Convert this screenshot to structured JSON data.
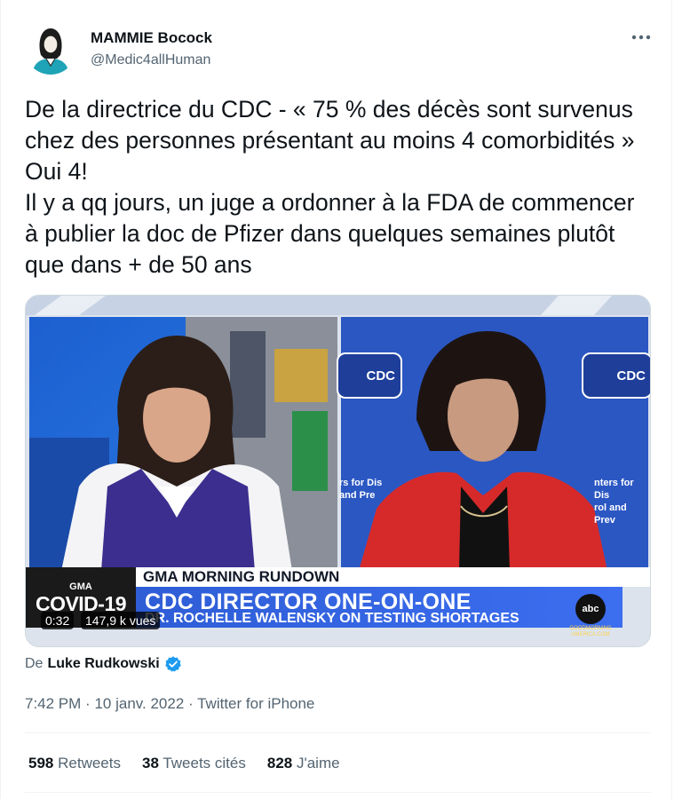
{
  "author": {
    "name": "MAMMIE Bocock",
    "handle": "@Medic4allHuman",
    "avatar_icon": "woman-portrait-avatar"
  },
  "more_icon": "more-options-icon",
  "tweet": {
    "text": "De la directrice du CDC - « 75 % des décès sont survenus chez des personnes présentant au moins 4 comorbidités » Oui 4!\nIl y a qq jours, un juge a ordonner à la FDA de commencer à publier la doc de Pfizer dans quelques semaines plutôt que dans + de 50 ans"
  },
  "video": {
    "duration": "0:32",
    "views": "147,9 k vues",
    "overlay": {
      "program": "GMA MORNING RUNDOWN",
      "headline": "CDC DIRECTOR ONE-ON-ONE",
      "subheadline": "DR. ROCHELLE WALENSKY ON TESTING SHORTAGES",
      "covid_small": "GMA",
      "covid_big": "COVID-19",
      "network": "abc",
      "network_url": "GOODMORNING AMERICA.COM",
      "cdc_logo": "CDC",
      "cdc_side_text": "nters for Dis\nrol and Prev",
      "cdc_side_text_left": "rs for Dis\nand Pre"
    }
  },
  "attribution": {
    "prefix": "De",
    "name": "Luke Rudkowski",
    "verified_icon": "verified-badge-icon"
  },
  "meta": {
    "time": "7:42 PM",
    "date": "10 janv. 2022",
    "source": "Twitter for iPhone",
    "separator": "·"
  },
  "stats": {
    "retweets_count": "598",
    "retweets_label": "Retweets",
    "quotes_count": "38",
    "quotes_label": "Tweets cités",
    "likes_count": "828",
    "likes_label": "J'aime"
  },
  "colors": {
    "text_primary": "#0f1419",
    "text_secondary": "#536471",
    "verified": "#1d9bf0",
    "divider": "#eff3f4"
  }
}
